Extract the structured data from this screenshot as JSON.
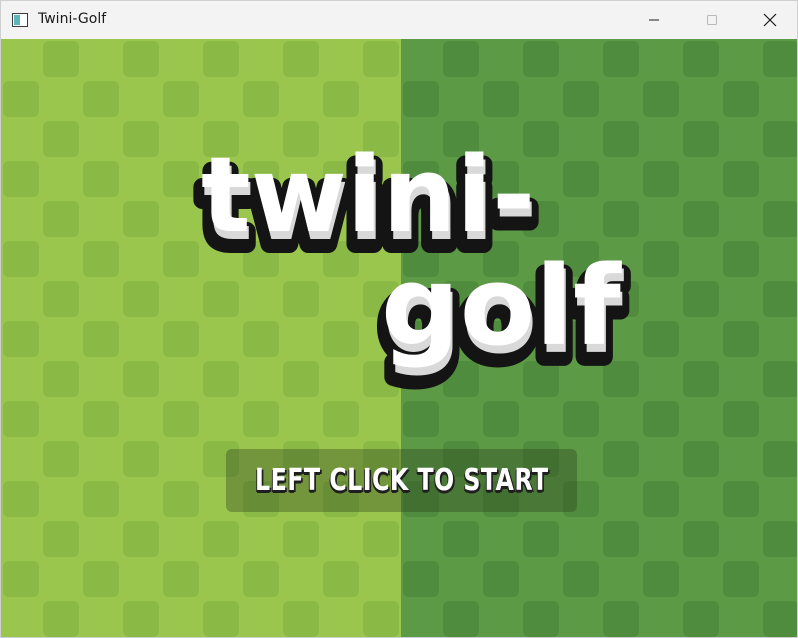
{
  "window": {
    "title": "Twini-Golf",
    "controls": {
      "minimize": "minimize",
      "maximize": "maximize",
      "close": "close"
    }
  },
  "game": {
    "logo": {
      "line1": "twini-",
      "line2": "golf"
    },
    "start_prompt": "LEFT CLICK TO START"
  },
  "colors": {
    "left_field": "#9bc64e",
    "left_tile": "#8ab946",
    "right_field": "#5c9a45",
    "right_tile": "#508c3d",
    "logo_fill": "#ffffff",
    "logo_shadow": "#d9d9d9",
    "logo_outline": "#141414"
  }
}
